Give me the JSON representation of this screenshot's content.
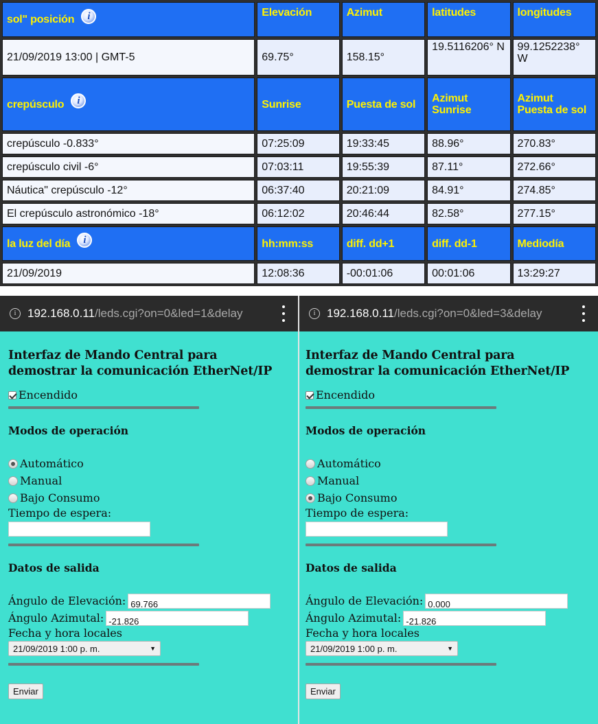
{
  "sun_table": {
    "position_header": {
      "label": "sol\" posición",
      "icon": "info-icon"
    },
    "position_columns": [
      "Elevación",
      "Azimut",
      "latitudes",
      "longitudes"
    ],
    "position_row": [
      "21/09/2019   13:00 | GMT-5",
      "69.75°",
      "158.15°",
      "19.5116206° N",
      "99.1252238° W"
    ],
    "twilight_header": {
      "label": "crepúsculo",
      "icon": "info-icon"
    },
    "twilight_columns": [
      "Sunrise",
      "Puesta de sol",
      "Azimut Sunrise",
      "Azimut Puesta de sol"
    ],
    "twilight_rows": [
      [
        "crepúsculo -0.833°",
        "07:25:09",
        "19:33:45",
        "88.96°",
        "270.83°"
      ],
      [
        "crepúsculo civil -6°",
        "07:03:11",
        "19:55:39",
        "87.11°",
        "272.66°"
      ],
      [
        "Náutica\" crepúsculo -12°",
        "06:37:40",
        "20:21:09",
        "84.91°",
        "274.85°"
      ],
      [
        "El crepúsculo astronómico -18°",
        "06:12:02",
        "20:46:44",
        "82.58°",
        "277.15°"
      ]
    ],
    "daylight_header": {
      "label": "la luz del día",
      "icon": "info-icon"
    },
    "daylight_columns": [
      "hh:mm:ss",
      "diff. dd+1",
      "diff. dd-1",
      "Mediodía"
    ],
    "daylight_row": [
      "21/09/2019",
      "12:08:36",
      "-00:01:06",
      "00:01:06",
      "13:29:27"
    ]
  },
  "phones": [
    {
      "url_host": "192.168.0.11",
      "url_path": "/leds.cgi?on=0&led=1&delay",
      "title": "Interfaz de Mando Central para demostrar la comunicación EtherNet/IP",
      "title_line1": "Interfaz de Mando Central para",
      "title_line2": "demostrar la comunicación EtherNet/IP",
      "power_label": "Encendido",
      "power_checked": true,
      "modes_heading": "Modos de operación",
      "modes": [
        {
          "label": "Automático",
          "selected": true
        },
        {
          "label": "Manual",
          "selected": false
        },
        {
          "label": "Bajo Consumo",
          "selected": false
        }
      ],
      "wait_label": "Tiempo de espera:",
      "wait_value": "",
      "output_heading": "Datos de salida",
      "elevation_label": "Ángulo de Elevación:",
      "elevation_value": "69.766",
      "azimuth_label": "Ángulo Azimutal:",
      "azimuth_value": "-21.826",
      "datetime_label": "Fecha y hora locales",
      "datetime_value": "21/09/2019 1:00 p. m.",
      "submit_label": "Enviar"
    },
    {
      "url_host": "192.168.0.11",
      "url_path": "/leds.cgi?on=0&led=3&delay",
      "title_line1": "Interfaz de Mando Central para",
      "title_line2": "demostrar la comunicación EtherNet/IP",
      "power_label": "Encendido",
      "power_checked": true,
      "modes_heading": "Modos de operación",
      "modes": [
        {
          "label": "Automático",
          "selected": false
        },
        {
          "label": "Manual",
          "selected": false
        },
        {
          "label": "Bajo Consumo",
          "selected": true
        }
      ],
      "wait_label": "Tiempo de espera:",
      "wait_value": "",
      "output_heading": "Datos de salida",
      "elevation_label": "Ángulo de Elevación:",
      "elevation_value": "0.000",
      "azimuth_label": "Ángulo Azimutal:",
      "azimuth_value": "-21.826",
      "datetime_label": "Fecha y hora locales",
      "datetime_value": "21/09/2019 1:00 p. m.",
      "submit_label": "Enviar"
    }
  ]
}
